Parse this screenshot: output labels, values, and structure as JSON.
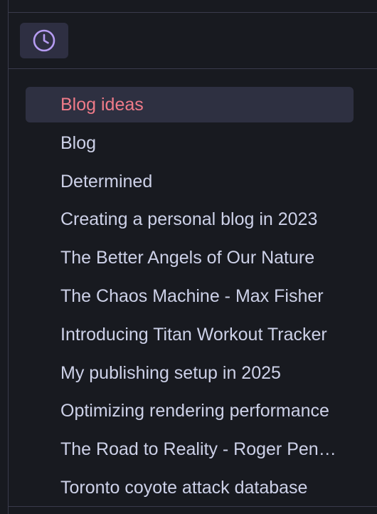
{
  "toolbar": {
    "recent_icon": "clock-icon",
    "accent_color": "#b69cf2"
  },
  "recent_notes": {
    "items": [
      {
        "label": "Blog ideas",
        "active": true
      },
      {
        "label": "Blog",
        "active": false
      },
      {
        "label": "Determined",
        "active": false
      },
      {
        "label": "Creating a personal blog in 2023",
        "active": false
      },
      {
        "label": "The Better Angels of Our Nature",
        "active": false
      },
      {
        "label": "The Chaos Machine - Max Fisher",
        "active": false
      },
      {
        "label": "Introducing Titan Workout Tracker",
        "active": false
      },
      {
        "label": "My publishing setup in 2025",
        "active": false
      },
      {
        "label": "Optimizing rendering performance",
        "active": false
      },
      {
        "label": "The Road to Reality - Roger Penrose",
        "active": false
      },
      {
        "label": "Toronto coyote attack database",
        "active": false
      }
    ],
    "active_color": "#f07b89",
    "text_color": "#cdd1e8"
  }
}
